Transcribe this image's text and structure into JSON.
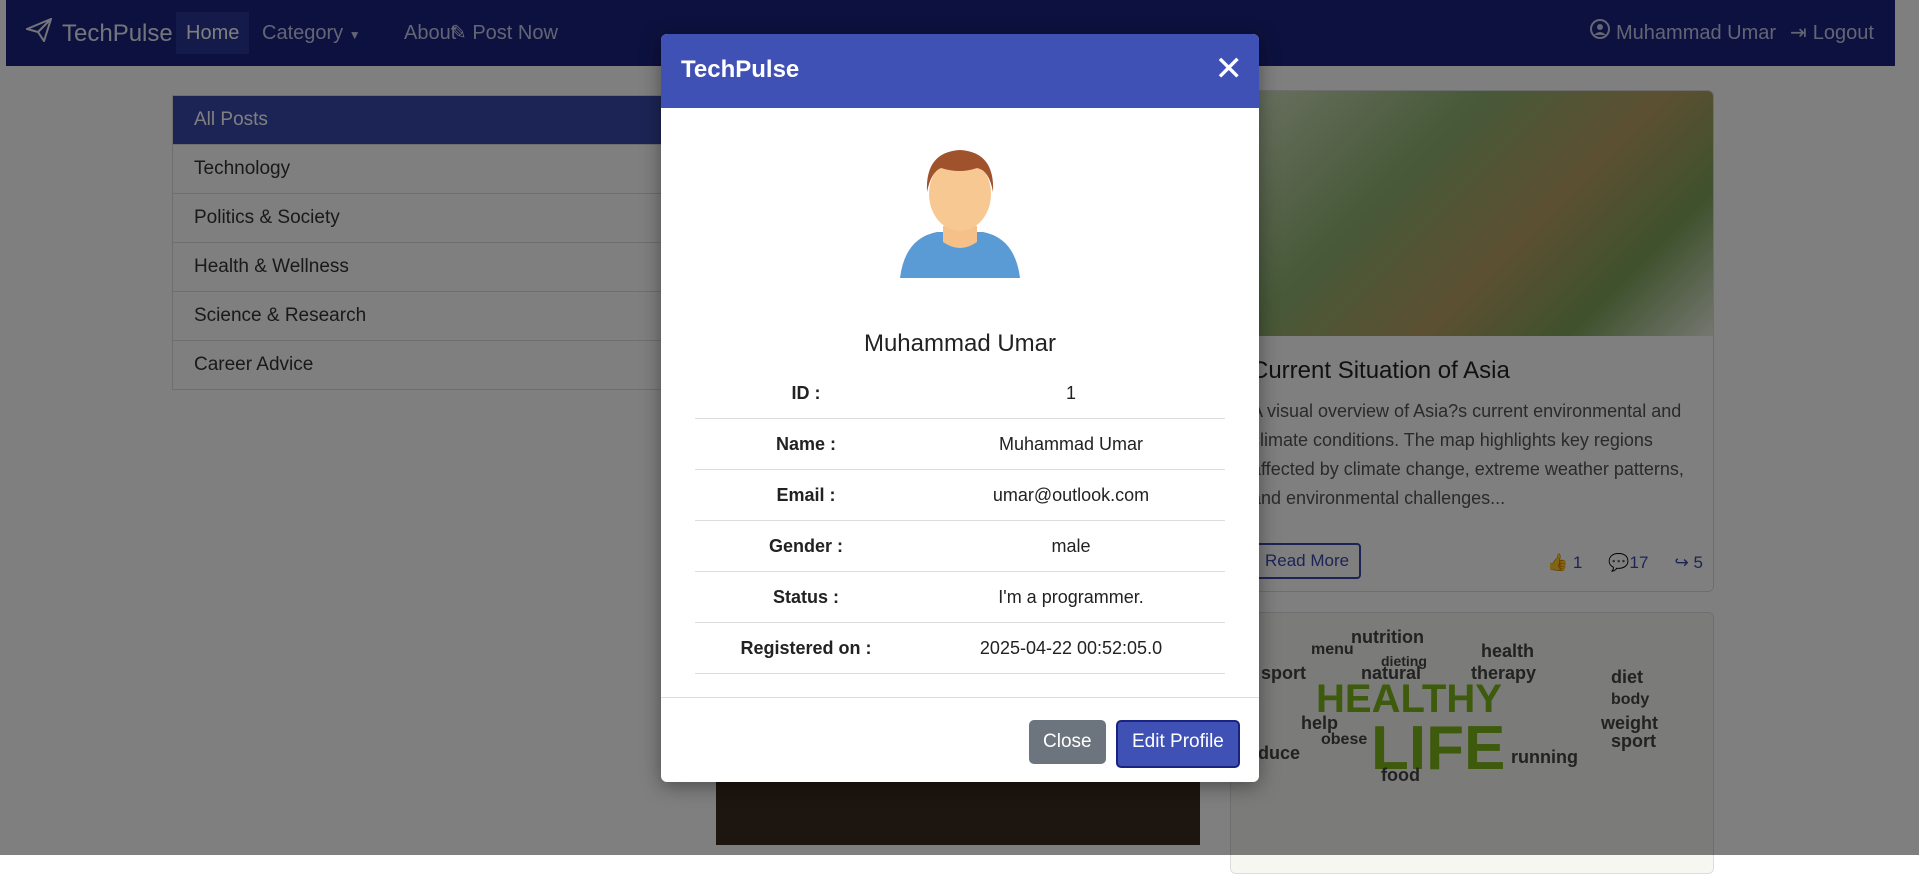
{
  "navbar": {
    "brand": "TechPulse",
    "items": [
      {
        "label": "Home",
        "active": true
      },
      {
        "label": "Category"
      },
      {
        "label": "About"
      },
      {
        "label": "Post Now"
      }
    ],
    "user_label": "Muhammad Umar",
    "logout_label": "Logout"
  },
  "categories": [
    {
      "label": "All Posts",
      "active": true
    },
    {
      "label": "Technology"
    },
    {
      "label": "Politics & Society"
    },
    {
      "label": "Health & Wellness"
    },
    {
      "label": "Science & Research"
    },
    {
      "label": "Career Advice"
    }
  ],
  "post": {
    "title": "Current Situation of Asia",
    "excerpt": "A visual overview of Asia?s current environmental and climate conditions. The map highlights key regions affected by climate change, extreme weather patterns, and environmental challenges...",
    "read_more": "Read More",
    "likes": "1",
    "comments": "17",
    "shares": "5"
  },
  "modal": {
    "title": "TechPulse",
    "user_name": "Muhammad Umar",
    "rows": [
      {
        "label": "ID :",
        "value": "1"
      },
      {
        "label": "Name :",
        "value": "Muhammad Umar"
      },
      {
        "label": "Email :",
        "value": "umar@outlook.com"
      },
      {
        "label": "Gender :",
        "value": "male"
      },
      {
        "label": "Status :",
        "value": "I'm a programmer."
      },
      {
        "label": "Registered on :",
        "value": "2025-04-22 00:52:05.0"
      }
    ],
    "close_label": "Close",
    "edit_label": "Edit Profile"
  },
  "wordcloud": [
    "nutrition",
    "menu",
    "health",
    "dieting",
    "sport",
    "natural",
    "therapy",
    "diet",
    "HEALTHY",
    "LIFE",
    "help",
    "weight",
    "reduce",
    "obese",
    "running",
    "food",
    "sport",
    "body"
  ],
  "colors": {
    "navbar": "#1a237e",
    "accent": "#3f51b5",
    "close_btn": "#6c757d"
  }
}
